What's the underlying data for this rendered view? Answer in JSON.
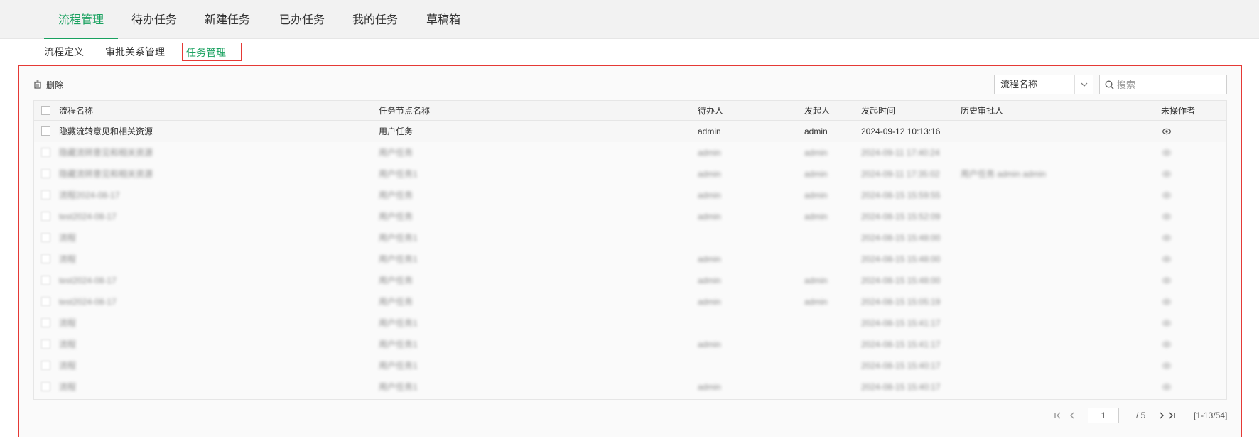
{
  "top_tabs": [
    {
      "label": "流程管理",
      "active": true
    },
    {
      "label": "待办任务",
      "active": false
    },
    {
      "label": "新建任务",
      "active": false
    },
    {
      "label": "已办任务",
      "active": false
    },
    {
      "label": "我的任务",
      "active": false
    },
    {
      "label": "草稿箱",
      "active": false
    }
  ],
  "sub_tabs": [
    {
      "label": "流程定义",
      "active": false
    },
    {
      "label": "审批关系管理",
      "active": false
    },
    {
      "label": "任务管理",
      "active": true
    }
  ],
  "toolbar": {
    "delete_label": "删除"
  },
  "filter": {
    "field_select": "流程名称",
    "search_placeholder": "搜索"
  },
  "table": {
    "columns": [
      "流程名称",
      "任务节点名称",
      "待办人",
      "发起人",
      "发起时间",
      "历史审批人",
      "未操作者"
    ],
    "rows": [
      {
        "name": "隐藏流转意见和相关资源",
        "node": "用户任务",
        "assignee": "admin",
        "starter": "admin",
        "start_time": "2024-09-12 10:13:16",
        "history": "",
        "blurred": false
      },
      {
        "name": "隐藏流转意见和相关资源",
        "node": "用户任务",
        "assignee": "admin",
        "starter": "admin",
        "start_time": "2024-09-11 17:40:24",
        "history": "",
        "blurred": true
      },
      {
        "name": "隐藏流转意见和相关资源",
        "node": "用户任务1",
        "assignee": "admin",
        "starter": "admin",
        "start_time": "2024-09-11 17:35:02",
        "history": "用户任务 admin admin",
        "blurred": true
      },
      {
        "name": "流程2024-08-17",
        "node": "用户任务",
        "assignee": "admin",
        "starter": "admin",
        "start_time": "2024-08-15 15:59:55",
        "history": "",
        "blurred": true
      },
      {
        "name": "test2024-08-17",
        "node": "用户任务",
        "assignee": "admin",
        "starter": "admin",
        "start_time": "2024-08-15 15:52:09",
        "history": "",
        "blurred": true
      },
      {
        "name": "流程",
        "node": "用户任务1",
        "assignee": "",
        "starter": "",
        "start_time": "2024-08-15 15:48:00",
        "history": "",
        "blurred": true
      },
      {
        "name": "流程",
        "node": "用户任务1",
        "assignee": "admin",
        "starter": "",
        "start_time": "2024-08-15 15:48:00",
        "history": "",
        "blurred": true
      },
      {
        "name": "test2024-08-17",
        "node": "用户任务",
        "assignee": "admin",
        "starter": "admin",
        "start_time": "2024-08-15 15:48:00",
        "history": "",
        "blurred": true
      },
      {
        "name": "test2024-08-17",
        "node": "用户任务",
        "assignee": "admin",
        "starter": "admin",
        "start_time": "2024-08-15 15:05:19",
        "history": "",
        "blurred": true
      },
      {
        "name": "流程",
        "node": "用户任务1",
        "assignee": "",
        "starter": "",
        "start_time": "2024-08-15 15:41:17",
        "history": "",
        "blurred": true
      },
      {
        "name": "流程",
        "node": "用户任务1",
        "assignee": "admin",
        "starter": "",
        "start_time": "2024-08-15 15:41:17",
        "history": "",
        "blurred": true
      },
      {
        "name": "流程",
        "node": "用户任务1",
        "assignee": "",
        "starter": "",
        "start_time": "2024-08-15 15:40:17",
        "history": "",
        "blurred": true
      },
      {
        "name": "流程",
        "node": "用户任务1",
        "assignee": "admin",
        "starter": "",
        "start_time": "2024-08-15 15:40:17",
        "history": "",
        "blurred": true
      }
    ]
  },
  "pagination": {
    "current_page": "1",
    "total_pages": "/ 5",
    "range": "[1-13/54]"
  },
  "colors": {
    "accent": "#19a15f",
    "highlight_border": "#e53935"
  },
  "icons": {
    "delete": "trash-icon",
    "dropdown": "chevron-down-icon",
    "search": "search-icon",
    "row_action": "eye-icon"
  }
}
